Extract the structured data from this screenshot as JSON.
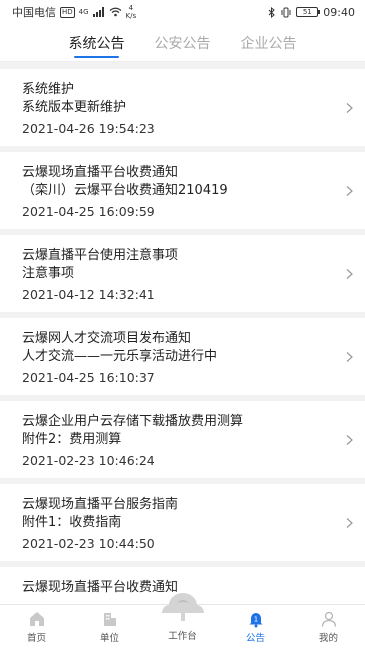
{
  "status_bar": {
    "carrier": "中国电信",
    "hd": "HD",
    "network": "4G",
    "speed_top": "4",
    "speed_unit": "K/s",
    "battery": "51",
    "time": "09:40"
  },
  "tabs": [
    {
      "label": "系统公告",
      "active": true
    },
    {
      "label": "公安公告",
      "active": false
    },
    {
      "label": "企业公告",
      "active": false
    }
  ],
  "notices": [
    {
      "title": "系统维护",
      "subtitle": "系统版本更新维护",
      "time": "2021-04-26 19:54:23"
    },
    {
      "title": "云爆现场直播平台收费通知",
      "subtitle": "（栾川）云爆平台收费通知210419",
      "time": "2021-04-25 16:09:59"
    },
    {
      "title": "云爆直播平台使用注意事项",
      "subtitle": "注意事项",
      "time": "2021-04-12 14:32:41"
    },
    {
      "title": "云爆网人才交流项目发布通知",
      "subtitle": "人才交流——一元乐享活动进行中",
      "time": "2021-04-25 16:10:37"
    },
    {
      "title": "云爆企业用户云存储下载播放费用测算",
      "subtitle": "附件2：费用测算",
      "time": "2021-02-23 10:46:24"
    },
    {
      "title": "云爆现场直播平台服务指南",
      "subtitle": "附件1：收费指南",
      "time": "2021-02-23 10:44:50"
    },
    {
      "title": "云爆现场直播平台收费通知"
    }
  ],
  "bottom_nav": [
    {
      "label": "首页",
      "icon": "home-icon",
      "active": false
    },
    {
      "label": "单位",
      "icon": "building-icon",
      "active": false
    },
    {
      "label": "工作台",
      "icon": "workbench-logo-icon",
      "active": false
    },
    {
      "label": "公告",
      "icon": "notice-bell-icon",
      "active": true,
      "badge": "1"
    },
    {
      "label": "我的",
      "icon": "profile-icon",
      "active": false
    }
  ],
  "colors": {
    "accent": "#1e73e8",
    "background": "#f2f2f2"
  }
}
